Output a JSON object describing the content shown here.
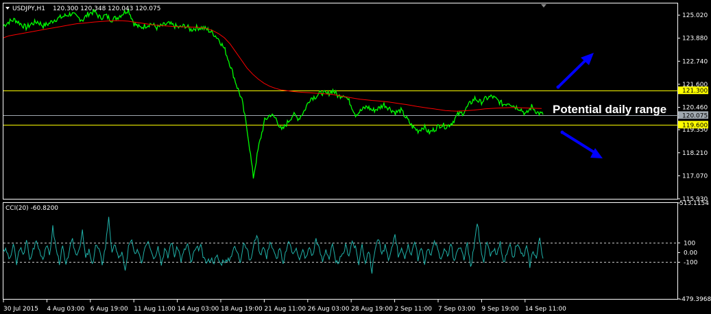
{
  "header": {
    "symbol": "USDJPY,H1",
    "ohlc": "120.300 120.348 120.043 120.075"
  },
  "indicator": {
    "label": "CCI(20) -60.8200"
  },
  "annotation": {
    "text": "Potential daily range"
  },
  "colors": {
    "background": "#000000",
    "price": "#00ff00",
    "moving_average": "#ff0000",
    "range_lines": "#ffff00",
    "cci": "#20b2aa",
    "arrows": "#0000ff",
    "frame": "#ffffff"
  },
  "chart_data": [
    {
      "type": "line",
      "series": [
        {
          "name": "USDJPY,H1",
          "y": [
            124.5,
            124.7,
            124.8,
            124.6,
            124.4,
            124.6,
            124.7,
            124.5,
            124.6,
            124.8,
            124.9,
            125.0,
            125.1,
            124.9,
            124.8,
            125.1,
            125.2,
            124.9,
            125.0,
            124.8,
            124.9,
            125.1,
            125.3,
            124.6,
            124.4,
            124.5,
            124.6,
            124.4,
            124.5,
            124.6,
            124.5,
            124.4,
            124.5,
            124.3,
            124.4,
            124.4,
            124.3,
            124.1,
            123.8,
            123.3,
            122.5,
            121.6,
            120.8,
            119.2,
            117.0,
            118.6,
            119.8,
            120.1,
            119.9,
            119.3,
            119.7,
            120.1,
            119.9,
            120.3,
            120.9,
            121.0,
            121.2,
            121.1,
            121.3,
            121.0,
            121.1,
            120.7,
            120.1,
            120.3,
            120.5,
            120.3,
            120.4,
            120.6,
            120.4,
            120.2,
            120.3,
            119.9,
            119.5,
            119.3,
            119.5,
            119.2,
            119.4,
            119.6,
            119.5,
            119.7,
            120.1,
            120.2,
            120.6,
            120.9,
            120.7,
            120.9,
            121.0,
            120.8,
            120.6,
            120.7,
            120.5,
            120.4,
            120.1,
            120.5,
            120.2,
            120.1
          ],
          "style": "price"
        },
        {
          "name": "",
          "y": [
            123.9,
            124.0,
            124.05,
            124.1,
            124.15,
            124.2,
            124.25,
            124.3,
            124.35,
            124.4,
            124.45,
            124.5,
            124.55,
            124.6,
            124.62,
            124.65,
            124.68,
            124.7,
            124.72,
            124.74,
            124.75,
            124.74,
            124.72,
            124.68,
            124.64,
            124.6,
            124.56,
            124.52,
            124.5,
            124.48,
            124.46,
            124.45,
            124.44,
            124.43,
            124.42,
            124.4,
            124.35,
            124.25,
            124.1,
            123.9,
            123.6,
            123.2,
            122.8,
            122.4,
            122.1,
            121.85,
            121.65,
            121.5,
            121.4,
            121.32,
            121.28,
            121.25,
            121.22,
            121.2,
            121.18,
            121.16,
            121.14,
            121.12,
            121.1,
            121.05,
            121.0,
            120.95,
            120.9,
            120.86,
            120.83,
            120.8,
            120.78,
            120.75,
            120.72,
            120.68,
            120.64,
            120.6,
            120.55,
            120.5,
            120.46,
            120.42,
            120.38,
            120.34,
            120.3,
            120.28,
            120.27,
            120.28,
            120.3,
            120.32,
            120.35,
            120.38,
            120.4,
            120.42,
            120.43,
            120.44,
            120.45,
            120.44,
            120.43,
            120.42,
            120.41,
            120.4
          ],
          "style": "ma"
        }
      ],
      "x_tick_labels": [
        "30 Jul 2015",
        "4 Aug 03:00",
        "6 Aug 19:00",
        "11 Aug 11:00",
        "14 Aug 03:00",
        "18 Aug 19:00",
        "21 Aug 11:00",
        "26 Aug 03:00",
        "28 Aug 19:00",
        "2 Sep 11:00",
        "7 Sep 03:00",
        "9 Sep 19:00",
        "14 Sep 11:00"
      ],
      "y_tick_labels": [
        "125.020",
        "123.880",
        "122.740",
        "121.600",
        "120.460",
        "119.350",
        "118.210",
        "117.070",
        "115.930"
      ],
      "ylim": [
        115.93,
        125.6
      ],
      "hlines": [
        {
          "value": 121.3,
          "label": "121.300",
          "color": "#ffff00"
        },
        {
          "value": 119.6,
          "label": "119.600",
          "color": "#ffff00"
        },
        {
          "value": 120.075,
          "label": "120.075",
          "color": "#a0a8b0"
        }
      ],
      "grid": false
    },
    {
      "type": "line",
      "series": [
        {
          "name": "CCI(20) -60.8200",
          "y": [
            40,
            10,
            -80,
            90,
            -120,
            60,
            -40,
            140,
            -90,
            30,
            120,
            20,
            -60,
            80,
            -30,
            260,
            40,
            -100,
            60,
            -150,
            30,
            120,
            -20,
            40,
            210,
            -60,
            20,
            -140,
            80,
            30,
            -110,
            60,
            380,
            -20,
            90,
            -80,
            20,
            -200,
            60,
            120,
            -40,
            30,
            -100,
            70,
            140,
            10,
            -60,
            90,
            -120,
            40,
            -50,
            120,
            -30,
            60,
            -80,
            20,
            90,
            -110,
            10,
            40,
            60,
            -80,
            -100,
            -60,
            -90,
            -40,
            -120,
            -70,
            -100,
            -50,
            60,
            10,
            -90,
            120,
            40,
            -100,
            60,
            200,
            -30,
            80,
            -60,
            130,
            20,
            -70,
            60,
            -140,
            40,
            110,
            -30,
            70,
            -80,
            20,
            -60,
            60,
            -40,
            150,
            30,
            -90,
            40,
            -60,
            80,
            -120,
            -80,
            -40,
            70,
            -20,
            120,
            40,
            -110,
            90,
            -100,
            30,
            -200,
            60,
            150,
            -40,
            80,
            -100,
            30,
            210,
            -30,
            60,
            -90,
            90,
            -20,
            130,
            -60,
            40,
            -100,
            60,
            -50,
            150,
            20,
            -80,
            60,
            -40,
            100,
            -100,
            20,
            30,
            -60,
            80,
            -150,
            40,
            320,
            60,
            -80,
            120,
            -60,
            40,
            -30,
            100,
            -120,
            -20,
            60,
            -60,
            90,
            30,
            -50,
            60,
            -130,
            30,
            -60,
            160,
            -60.82
          ],
          "style": "cci"
        }
      ],
      "y_tick_labels": [
        "513.1154",
        "100",
        "0.00",
        "-100",
        "-479.3968"
      ],
      "ylim": [
        -479.3968,
        513.1154
      ],
      "hlines": [
        {
          "value": 100,
          "label": "100"
        },
        {
          "value": -100,
          "label": "-100"
        }
      ],
      "grid": false
    }
  ]
}
